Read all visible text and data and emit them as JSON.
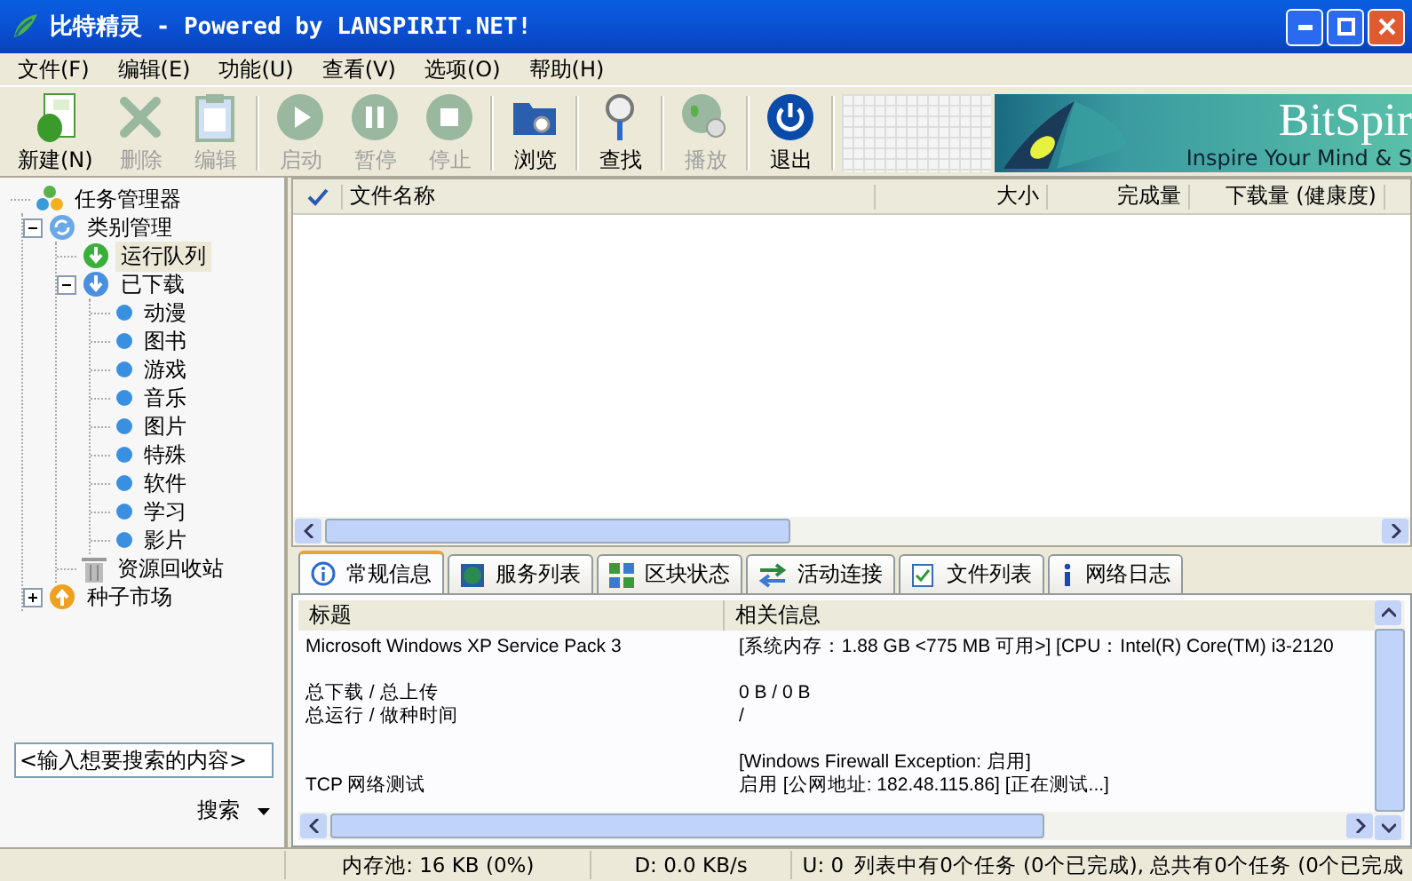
{
  "window": {
    "title": "比特精灵 - Powered by LANSPIRIT.NET!"
  },
  "menu": [
    "文件(F)",
    "编辑(E)",
    "功能(U)",
    "查看(V)",
    "选项(O)",
    "帮助(H)"
  ],
  "toolbar": [
    {
      "label": "新建(N)",
      "kind": "new",
      "disabled": false
    },
    {
      "label": "删除",
      "kind": "delete",
      "disabled": true
    },
    {
      "label": "编辑",
      "kind": "edit",
      "disabled": true
    },
    {
      "label": "启动",
      "kind": "start",
      "disabled": true
    },
    {
      "label": "暂停",
      "kind": "pause",
      "disabled": true
    },
    {
      "label": "停止",
      "kind": "stop",
      "disabled": true
    },
    {
      "label": "浏览",
      "kind": "browse",
      "disabled": false
    },
    {
      "label": "查找",
      "kind": "find",
      "disabled": false
    },
    {
      "label": "播放",
      "kind": "play",
      "disabled": true
    },
    {
      "label": "退出",
      "kind": "exit",
      "disabled": false
    }
  ],
  "banner": {
    "title": "BitSpir",
    "slogan": "Inspire Your Mind & S"
  },
  "tree": [
    {
      "label": "任务管理器",
      "kind": "root",
      "children": [
        {
          "label": "类别管理",
          "kind": "category",
          "expanded": true,
          "selected": false,
          "children": [
            {
              "label": "运行队列",
              "kind": "queue",
              "selected": true
            },
            {
              "label": "已下载",
              "kind": "downloaded",
              "expanded": true,
              "selected": false,
              "children": [
                {
                  "label": "动漫",
                  "kind": "dot",
                  "selected": false
                },
                {
                  "label": "图书",
                  "kind": "dot",
                  "selected": false
                },
                {
                  "label": "游戏",
                  "kind": "dot",
                  "selected": false
                },
                {
                  "label": "音乐",
                  "kind": "dot",
                  "selected": false
                },
                {
                  "label": "图片",
                  "kind": "dot",
                  "selected": false
                },
                {
                  "label": "特殊",
                  "kind": "dot",
                  "selected": false
                },
                {
                  "label": "软件",
                  "kind": "dot",
                  "selected": false
                },
                {
                  "label": "学习",
                  "kind": "dot",
                  "selected": false
                },
                {
                  "label": "影片",
                  "kind": "dot",
                  "selected": false
                }
              ]
            },
            {
              "label": "资源回收站",
              "kind": "trash",
              "selected": false
            }
          ]
        },
        {
          "label": "种子市场",
          "kind": "market",
          "expanded": false,
          "selected": false
        }
      ]
    }
  ],
  "search": {
    "placeholder": "<输入想要搜索的内容>",
    "button": "搜索"
  },
  "file_list": {
    "columns": [
      "文件名称",
      "大小",
      "完成量",
      "下载量 (健康度)"
    ]
  },
  "tabs": [
    {
      "label": "常规信息",
      "kind": "info",
      "selected": true
    },
    {
      "label": "服务列表",
      "kind": "globe",
      "selected": false
    },
    {
      "label": "区块状态",
      "kind": "blocks",
      "selected": false
    },
    {
      "label": "活动连接",
      "kind": "arrows",
      "selected": false
    },
    {
      "label": "文件列表",
      "kind": "files",
      "selected": false
    },
    {
      "label": "网络日志",
      "kind": "log",
      "selected": false
    }
  ],
  "info_table": {
    "columns": [
      "标题",
      "相关信息"
    ],
    "rows": [
      {
        "kind": "row",
        "title": "Microsoft Windows XP Service Pack 3",
        "info": "[系统内存：1.88 GB <775 MB 可用>] [CPU：Intel(R) Core(TM) i3-2120"
      },
      {
        "kind": "blank"
      },
      {
        "kind": "row",
        "title": "总下载 / 总上传",
        "info": "0 B / 0 B"
      },
      {
        "kind": "row",
        "title": "总运行 / 做种时间",
        "info": "/"
      },
      {
        "kind": "blank"
      },
      {
        "kind": "row",
        "info": "[Windows Firewall Exception: 启用]"
      },
      {
        "kind": "row",
        "title": "TCP 网络测试",
        "info": "启用 [公网地址: 182.48.115.86] [正在测试...]"
      }
    ]
  },
  "status_bar": [
    "内存池: 16 KB (0%)",
    "D: 0.0 KB/s",
    "U: 0",
    "列表中有0个任务 (0个已完成), 总共有0个任务 (0个已完成"
  ]
}
